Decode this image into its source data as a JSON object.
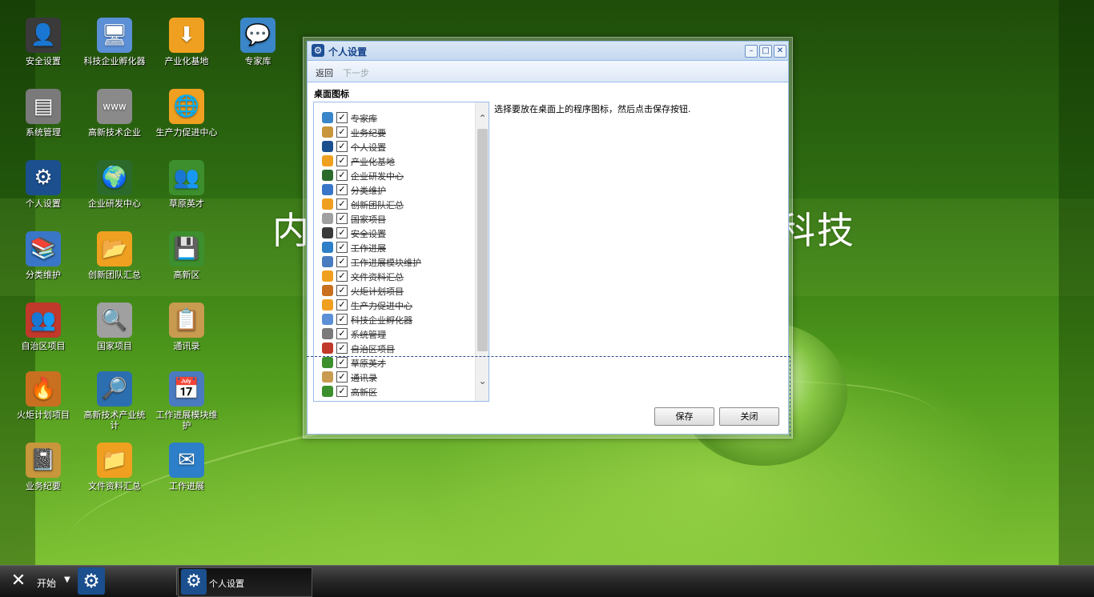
{
  "desktop": {
    "banner_left": "内",
    "banner_right": "科技",
    "icons": [
      {
        "label": "安全设置",
        "icon": "user-suit-icon",
        "color": "#3a3a3a",
        "glyph": "👤"
      },
      {
        "label": "科技企业孵化器",
        "icon": "monitor-icon",
        "color": "#5b8fd6",
        "glyph": "🖥"
      },
      {
        "label": "产业化基地",
        "icon": "download-arrow-icon",
        "color": "#f0a020",
        "glyph": "⬇"
      },
      {
        "label": "专家库",
        "icon": "expert-chat-icon",
        "color": "#3a86c8",
        "glyph": "💬"
      },
      {
        "label": "系统管理",
        "icon": "hard-drive-icon",
        "color": "#7a7a7a",
        "glyph": "▤"
      },
      {
        "label": "高新技术企业",
        "icon": "web-page-icon",
        "color": "#8a8a8a",
        "glyph": "www"
      },
      {
        "label": "生产力促进中心",
        "icon": "globe-folder-icon",
        "color": "#f0a020",
        "glyph": "🌐"
      },
      {
        "label": "个人设置",
        "icon": "gears-icon",
        "color": "#1b4f8e",
        "glyph": "⚙"
      },
      {
        "label": "企业研发中心",
        "icon": "globe-icon",
        "color": "#2c6a2c",
        "glyph": "🌍"
      },
      {
        "label": "草原英才",
        "icon": "users-icon",
        "color": "#3d8f2e",
        "glyph": "👥"
      },
      {
        "label": "分类维护",
        "icon": "books-icon",
        "color": "#3a76c8",
        "glyph": "📚"
      },
      {
        "label": "创新团队汇总",
        "icon": "folder-stack-icon",
        "color": "#f0a020",
        "glyph": "📂"
      },
      {
        "label": "高新区",
        "icon": "floppy-add-icon",
        "color": "#3d8f2e",
        "glyph": "💾"
      },
      {
        "label": "自治区项目",
        "icon": "people-group-icon",
        "color": "#c0392b",
        "glyph": "👥"
      },
      {
        "label": "国家项目",
        "icon": "magnifier-doc-icon",
        "color": "#a0a0a0",
        "glyph": "🔍"
      },
      {
        "label": "通讯录",
        "icon": "clipboard-icon",
        "color": "#c89b50",
        "glyph": "📋"
      },
      {
        "label": "火炬计划项目",
        "icon": "torch-icon",
        "color": "#c87020",
        "glyph": "🔥"
      },
      {
        "label": "高新技术产业统计",
        "icon": "search-icon",
        "color": "#2c6fb0",
        "glyph": "🔎"
      },
      {
        "label": "工作进展模块维护",
        "icon": "calendar-icon",
        "color": "#4a7bc0",
        "glyph": "📅"
      },
      {
        "label": "业务纪要",
        "icon": "notebook-icon",
        "color": "#c8963c",
        "glyph": "📓"
      },
      {
        "label": "文件资料汇总",
        "icon": "folder-icon",
        "color": "#f0a020",
        "glyph": "📁"
      },
      {
        "label": "工作进展",
        "icon": "mail-icon",
        "color": "#2c7fc8",
        "glyph": "✉"
      }
    ]
  },
  "window": {
    "title": "个人设置",
    "toolbar": {
      "back": "返回",
      "next": "下一步"
    },
    "section_title": "桌面图标",
    "instruction": "选择要放在桌面上的程序图标，然后点击保存按钮.",
    "items": [
      {
        "label": "专家库",
        "icon": "expert-chat-icon",
        "color": "#3a86c8",
        "checked": "✓"
      },
      {
        "label": "业务纪要",
        "icon": "notebook-icon",
        "color": "#c8963c",
        "checked": "✓"
      },
      {
        "label": "个人设置",
        "icon": "gears-icon",
        "color": "#1b4f8e",
        "checked": "✓"
      },
      {
        "label": "产业化基地",
        "icon": "download-arrow-icon",
        "color": "#f0a020",
        "checked": "✓"
      },
      {
        "label": "企业研发中心",
        "icon": "globe-icon",
        "color": "#2c6a2c",
        "checked": "✓"
      },
      {
        "label": "分类维护",
        "icon": "books-icon",
        "color": "#3a76c8",
        "checked": "✓"
      },
      {
        "label": "创新团队汇总",
        "icon": "folder-stack-icon",
        "color": "#f0a020",
        "checked": "✓"
      },
      {
        "label": "国家项目",
        "icon": "magnifier-doc-icon",
        "color": "#a0a0a0",
        "checked": "✓"
      },
      {
        "label": "安全设置",
        "icon": "user-suit-icon",
        "color": "#3a3a3a",
        "checked": "✓"
      },
      {
        "label": "工作进展",
        "icon": "mail-icon",
        "color": "#2c7fc8",
        "checked": "✓"
      },
      {
        "label": "工作进展模块维护",
        "icon": "calendar-icon",
        "color": "#4a7bc0",
        "checked": "✓"
      },
      {
        "label": "文件资料汇总",
        "icon": "folder-icon",
        "color": "#f0a020",
        "checked": "✓"
      },
      {
        "label": "火炬计划项目",
        "icon": "torch-icon",
        "color": "#c87020",
        "checked": "✓"
      },
      {
        "label": "生产力促进中心",
        "icon": "globe-folder-icon",
        "color": "#f0a020",
        "checked": "✓"
      },
      {
        "label": "科技企业孵化器",
        "icon": "monitor-icon",
        "color": "#5b8fd6",
        "checked": "✓"
      },
      {
        "label": "系统管理",
        "icon": "hard-drive-icon",
        "color": "#7a7a7a",
        "checked": "✓"
      },
      {
        "label": "自治区项目",
        "icon": "people-group-icon",
        "color": "#c0392b",
        "checked": "✓"
      },
      {
        "label": "草原英才",
        "icon": "users-icon",
        "color": "#3d8f2e",
        "checked": "✓"
      },
      {
        "label": "通讯录",
        "icon": "clipboard-icon",
        "color": "#c89b50",
        "checked": "✓"
      },
      {
        "label": "高新区",
        "icon": "floppy-add-icon",
        "color": "#3d8f2e",
        "checked": "✓"
      }
    ],
    "buttons": {
      "save": "保存",
      "close": "关闭"
    }
  },
  "taskbar": {
    "start_label": "开始",
    "task_label": "个人设置"
  }
}
